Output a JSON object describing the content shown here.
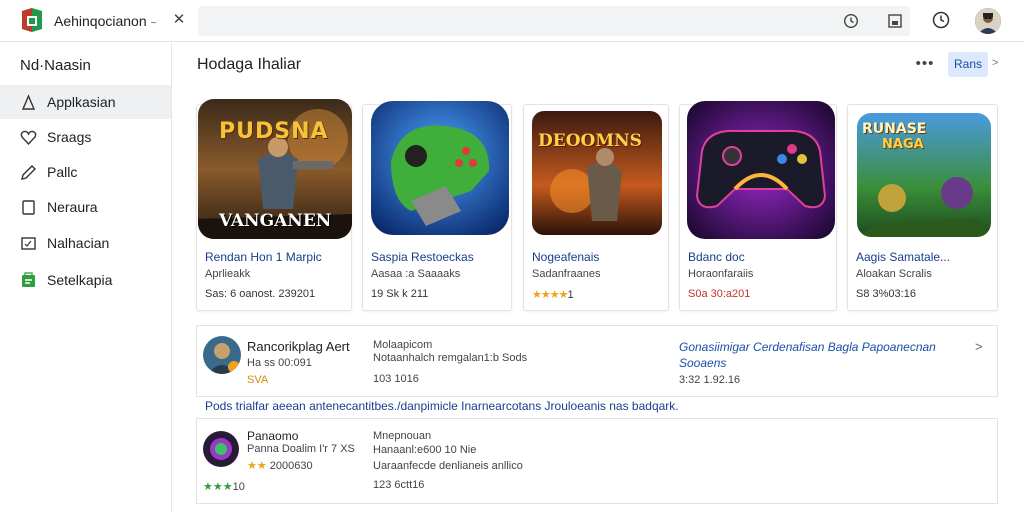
{
  "window": {
    "app_title": "Aehinqocianon",
    "title_chevron": "~",
    "close_glyph": "✕"
  },
  "sidebar": {
    "heading": "Nd·Naasin",
    "items": [
      {
        "label": "Applkasian",
        "icon": "person-icon"
      },
      {
        "label": "Sraags",
        "icon": "heart-icon"
      },
      {
        "label": "Pallc",
        "icon": "pencil-icon"
      },
      {
        "label": "Neraura",
        "icon": "bookmark-icon"
      },
      {
        "label": "Nalhacian",
        "icon": "image-icon"
      },
      {
        "label": "Setelkapia",
        "icon": "store-icon"
      }
    ]
  },
  "main": {
    "title": "Hodaga Ihaliar",
    "more_glyph": "•••",
    "primary_button": "Rans",
    "next_glyph": ">"
  },
  "cards": [
    {
      "title": "Rendan Hon 1 Marpic",
      "subtitle": "Aprlieakk",
      "meta": "Sas: 6 oanost. 239201",
      "art_text_top": "PUDSNA",
      "art_text_bottom": "VANGANEN",
      "art_color": "#b8892e"
    },
    {
      "title": "Saspia Restoeckas",
      "subtitle": "Aasaa :a Saaaaks",
      "meta": "19 Sk k 211",
      "art_color": "#2f6fd0"
    },
    {
      "title": "Nogeafenais",
      "subtitle": "Sadanfraanes",
      "meta_stars": "★★★★",
      "meta": "1",
      "art_text_top": "DEOOMNS",
      "art_color": "#c65a1e"
    },
    {
      "title": "Bdanc doc",
      "subtitle": "Horaonfaraiis",
      "meta": "S0a 30:a201",
      "meta_red": true,
      "art_color": "#7a1e9e"
    },
    {
      "title": "Aagis Samatale...",
      "subtitle": "Aloakan Scralis",
      "meta": "S8 3%03:16",
      "art_text_top": "RUNASE",
      "art_text_bottom": "NAGA",
      "art_color": "#3a8f3a"
    }
  ],
  "rows": [
    {
      "name": "Rancorikplag Aert",
      "sub1": "Ha ss 00:091",
      "sub2": "SVA",
      "col2_line1": "Molaapicom",
      "col2_line2": "Notaanhalch remgalan1:b Sods",
      "col2_line3": "103 1016",
      "link_line1": "Gonasiimigar Cerdenafisan Bagla Papoanecnan",
      "link_line2": "Sooaens",
      "link_meta": "3:32 1.92.16",
      "chevron": ">"
    },
    {
      "name": "Panaomo",
      "sub1": "Panna Doalim I'r 7 XS",
      "sub_stars": "★★",
      "sub2": "2000630",
      "sub3_stars": "★★★",
      "sub3": "10",
      "col2_line1": "Mnepnouan",
      "col2_line2": "Hanaanl:e600 10 Nie",
      "col2_line3": "Uaraanfecde denlianeis anllico",
      "col2_line4": "123 6ctt16"
    }
  ],
  "footnote": "Pods trialfar aeean antenecantitbes./danpimicle Inarnearcotans Jrouloeanis nas badqark.",
  "colors": {
    "accent": "#1a4fa8",
    "link": "#1a3d8f",
    "star": "#f0a21a",
    "active_bg": "#eef0f2"
  }
}
